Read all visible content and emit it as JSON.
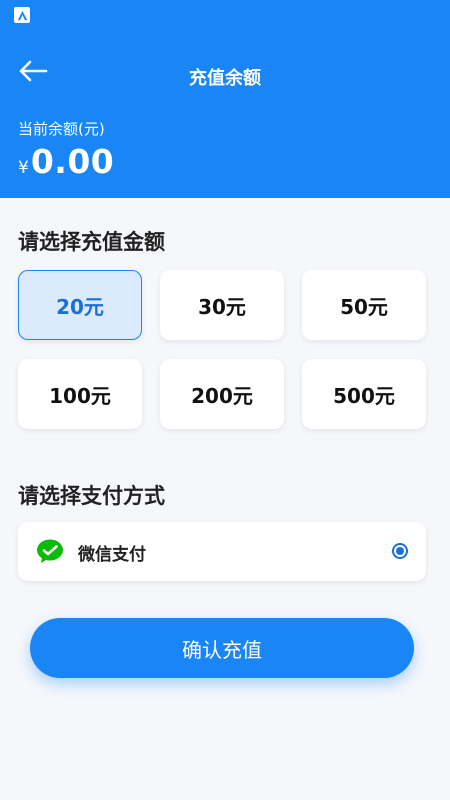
{
  "colors": {
    "primary": "#1a86f5",
    "selected_bg": "#dceafd",
    "selected_text": "#1a6fd6",
    "page_bg": "#f5f7fb",
    "wechat_green": "#09bb07"
  },
  "status_bar": {
    "app_icon": "app-launcher-icon"
  },
  "header": {
    "back_icon": "arrow-left-icon",
    "title": "充值余额",
    "balance_label": "当前余额(元)",
    "currency_symbol": "¥",
    "balance_value": "0.00"
  },
  "amount_section": {
    "title": "请选择充值金额",
    "options": [
      "20元",
      "30元",
      "50元",
      "100元",
      "200元",
      "500元"
    ],
    "selected": "20元"
  },
  "payment_section": {
    "title": "请选择支付方式",
    "method": {
      "icon": "wechat-pay-icon",
      "label": "微信支付",
      "selected": true
    }
  },
  "confirm_button": {
    "label": "确认充值"
  }
}
